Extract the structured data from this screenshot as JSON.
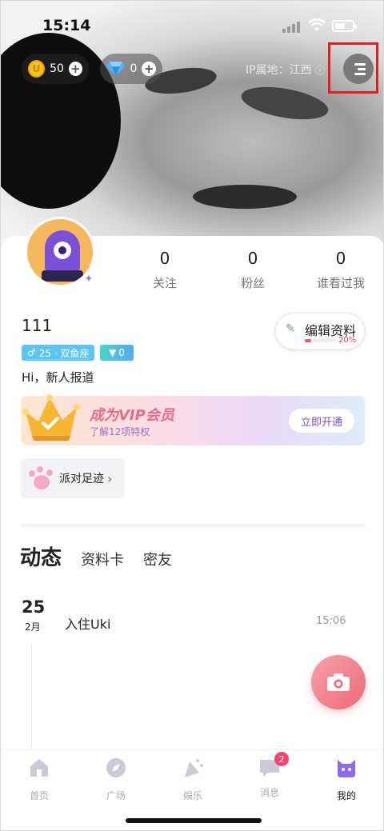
{
  "status_bar": {
    "time": "15:14"
  },
  "top": {
    "coins": "50",
    "gems": "0",
    "ip_location": "IP属地：江西"
  },
  "profile": {
    "stats": [
      {
        "value": "0",
        "label": "关注"
      },
      {
        "value": "0",
        "label": "粉丝"
      },
      {
        "value": "0",
        "label": "谁看过我"
      }
    ],
    "username": "111",
    "edit_label": "编辑资料",
    "completion": "20%",
    "completion_fraction": 0.2,
    "gender_tag": "25 · 双鱼座",
    "level_tag": "0",
    "bio": "Hi，新人报道"
  },
  "vip": {
    "title": "成为VIP会员",
    "subtitle": "了解12项特权",
    "button": "立即开通"
  },
  "party": {
    "label": "派对足迹"
  },
  "tabs": [
    {
      "label": "动态",
      "active": true
    },
    {
      "label": "资料卡",
      "active": false
    },
    {
      "label": "密友",
      "active": false
    }
  ],
  "feed": {
    "day": "25",
    "month": "2月",
    "text": "入住Uki",
    "time": "15:06"
  },
  "tabbar": {
    "items": [
      {
        "label": "首页",
        "icon": "home-icon"
      },
      {
        "label": "广场",
        "icon": "compass-icon"
      },
      {
        "label": "娱乐",
        "icon": "party-icon"
      },
      {
        "label": "消息",
        "icon": "message-icon",
        "badge": "2"
      },
      {
        "label": "我的",
        "icon": "profile-icon",
        "active": true
      }
    ]
  },
  "colors": {
    "accent_pink": "#ee6a78",
    "vip_purple": "#7e4fc0",
    "gender_blue": "#5bc6f3",
    "badge_red": "#f2456b"
  }
}
